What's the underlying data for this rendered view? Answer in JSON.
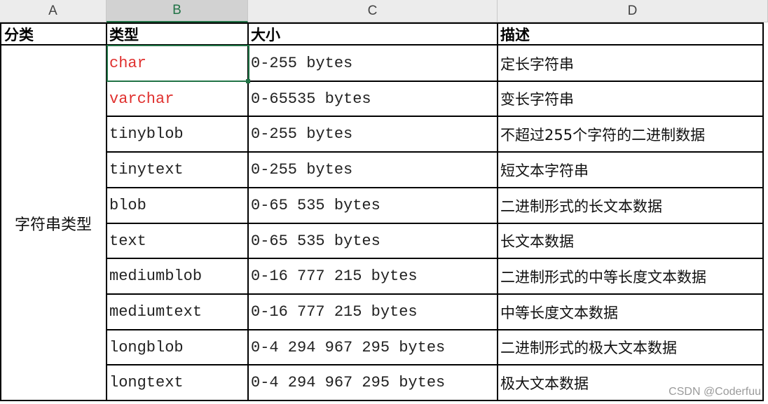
{
  "columns": [
    "A",
    "B",
    "C",
    "D"
  ],
  "headers": {
    "category": "分类",
    "type": "类型",
    "size": "大小",
    "description": "描述"
  },
  "category_label": "字符串类型",
  "rows": [
    {
      "type": "char",
      "size": "0-255 bytes",
      "description": "定长字符串",
      "highlight": true
    },
    {
      "type": "varchar",
      "size": "0-65535 bytes",
      "description": "变长字符串",
      "highlight": true
    },
    {
      "type": "tinyblob",
      "size": "0-255 bytes",
      "description": "不超过255个字符的二进制数据",
      "highlight": false
    },
    {
      "type": "tinytext",
      "size": "0-255 bytes",
      "description": "短文本字符串",
      "highlight": false
    },
    {
      "type": "blob",
      "size": "0-65 535 bytes",
      "description": "二进制形式的长文本数据",
      "highlight": false
    },
    {
      "type": "text",
      "size": "0-65 535 bytes",
      "description": "长文本数据",
      "highlight": false
    },
    {
      "type": "mediumblob",
      "size": "0-16 777 215 bytes",
      "description": "二进制形式的中等长度文本数据",
      "highlight": false
    },
    {
      "type": "mediumtext",
      "size": "0-16 777 215 bytes",
      "description": "中等长度文本数据",
      "highlight": false
    },
    {
      "type": "longblob",
      "size": "0-4 294 967 295 bytes",
      "description": "二进制形式的极大文本数据",
      "highlight": false
    },
    {
      "type": "longtext",
      "size": "0-4 294 967 295 bytes",
      "description": "极大文本数据",
      "highlight": false
    }
  ],
  "watermark": "CSDN @Coderfuu",
  "colors": {
    "highlight_text": "#e0312f",
    "selection": "#217346"
  }
}
